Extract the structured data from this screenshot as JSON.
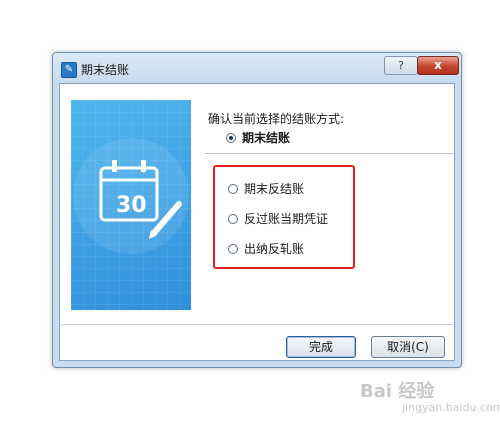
{
  "window": {
    "title": "期末结账",
    "help_label": "?",
    "close_label": "x"
  },
  "banner": {
    "date_number": "30"
  },
  "content": {
    "prompt": "确认当前选择的结账方式:",
    "options": [
      {
        "label": "期末结账",
        "checked": true
      },
      {
        "label": "期末反结账",
        "checked": false
      },
      {
        "label": "反过账当期凭证",
        "checked": false
      },
      {
        "label": "出纳反轧账",
        "checked": false
      }
    ]
  },
  "buttons": {
    "finish": "完成",
    "cancel": "取消(C)"
  },
  "watermark": {
    "text": "Bai 经验",
    "sub": "jingyan.baidu.com"
  },
  "colors": {
    "highlight": "#e02020",
    "banner": "#3fa2e6"
  }
}
